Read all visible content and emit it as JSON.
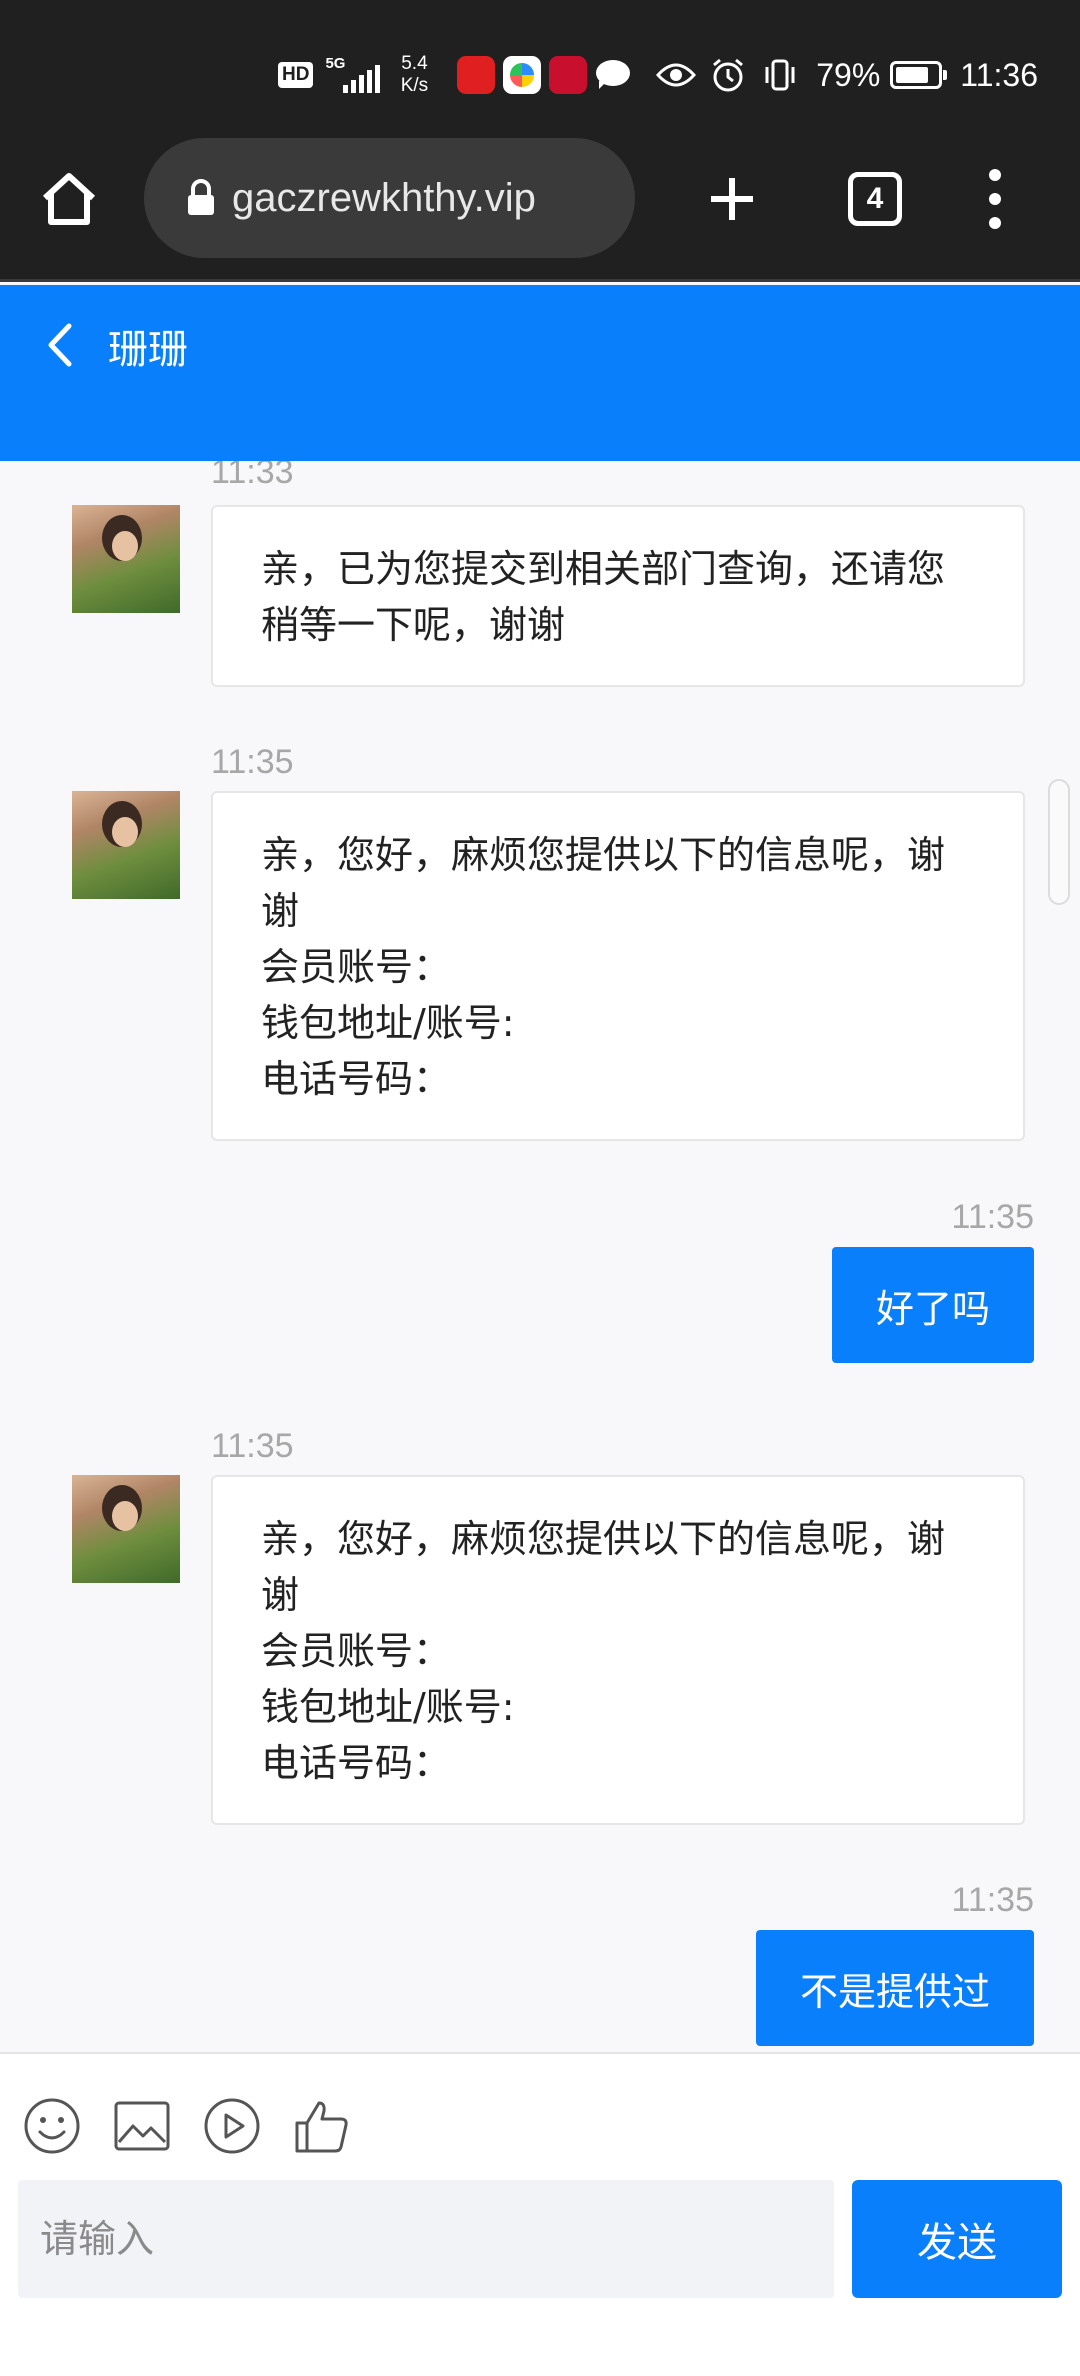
{
  "status_bar": {
    "hd_badge": "HD",
    "network_label": "5G",
    "speed_value": "5.4",
    "speed_unit": "K/s",
    "battery_percent": "79%",
    "battery_level": 0.79,
    "time": "11:36"
  },
  "browser": {
    "url": "gaczrewkhthy.vip",
    "tab_count": "4"
  },
  "chat": {
    "contact_name": "珊珊",
    "messages": [
      {
        "direction": "incoming",
        "time": "11:33",
        "text": "亲，已为您提交到相关部门查询，还请您\n稍等一下呢，谢谢"
      },
      {
        "direction": "incoming",
        "time": "11:35",
        "text": "亲，您好，麻烦您提供以下的信息呢，谢\n谢\n会员账号：\n钱包地址/账号:\n电话号码："
      },
      {
        "direction": "outgoing",
        "time": "11:35",
        "text": "好了吗"
      },
      {
        "direction": "incoming",
        "time": "11:35",
        "text": "亲，您好，麻烦您提供以下的信息呢，谢\n谢\n会员账号：\n钱包地址/账号:\n电话号码："
      },
      {
        "direction": "outgoing",
        "time": "11:35",
        "text": "不是提供过"
      }
    ]
  },
  "composer": {
    "tools": [
      "emoji-icon",
      "image-icon",
      "video-play-icon",
      "thumbs-up-icon"
    ],
    "input_placeholder": "请输入",
    "input_value": "",
    "send_label": "发送"
  },
  "colors": {
    "accent": "#0a7ffb",
    "browser_bar": "#202020",
    "background": "#f8f8fa"
  }
}
